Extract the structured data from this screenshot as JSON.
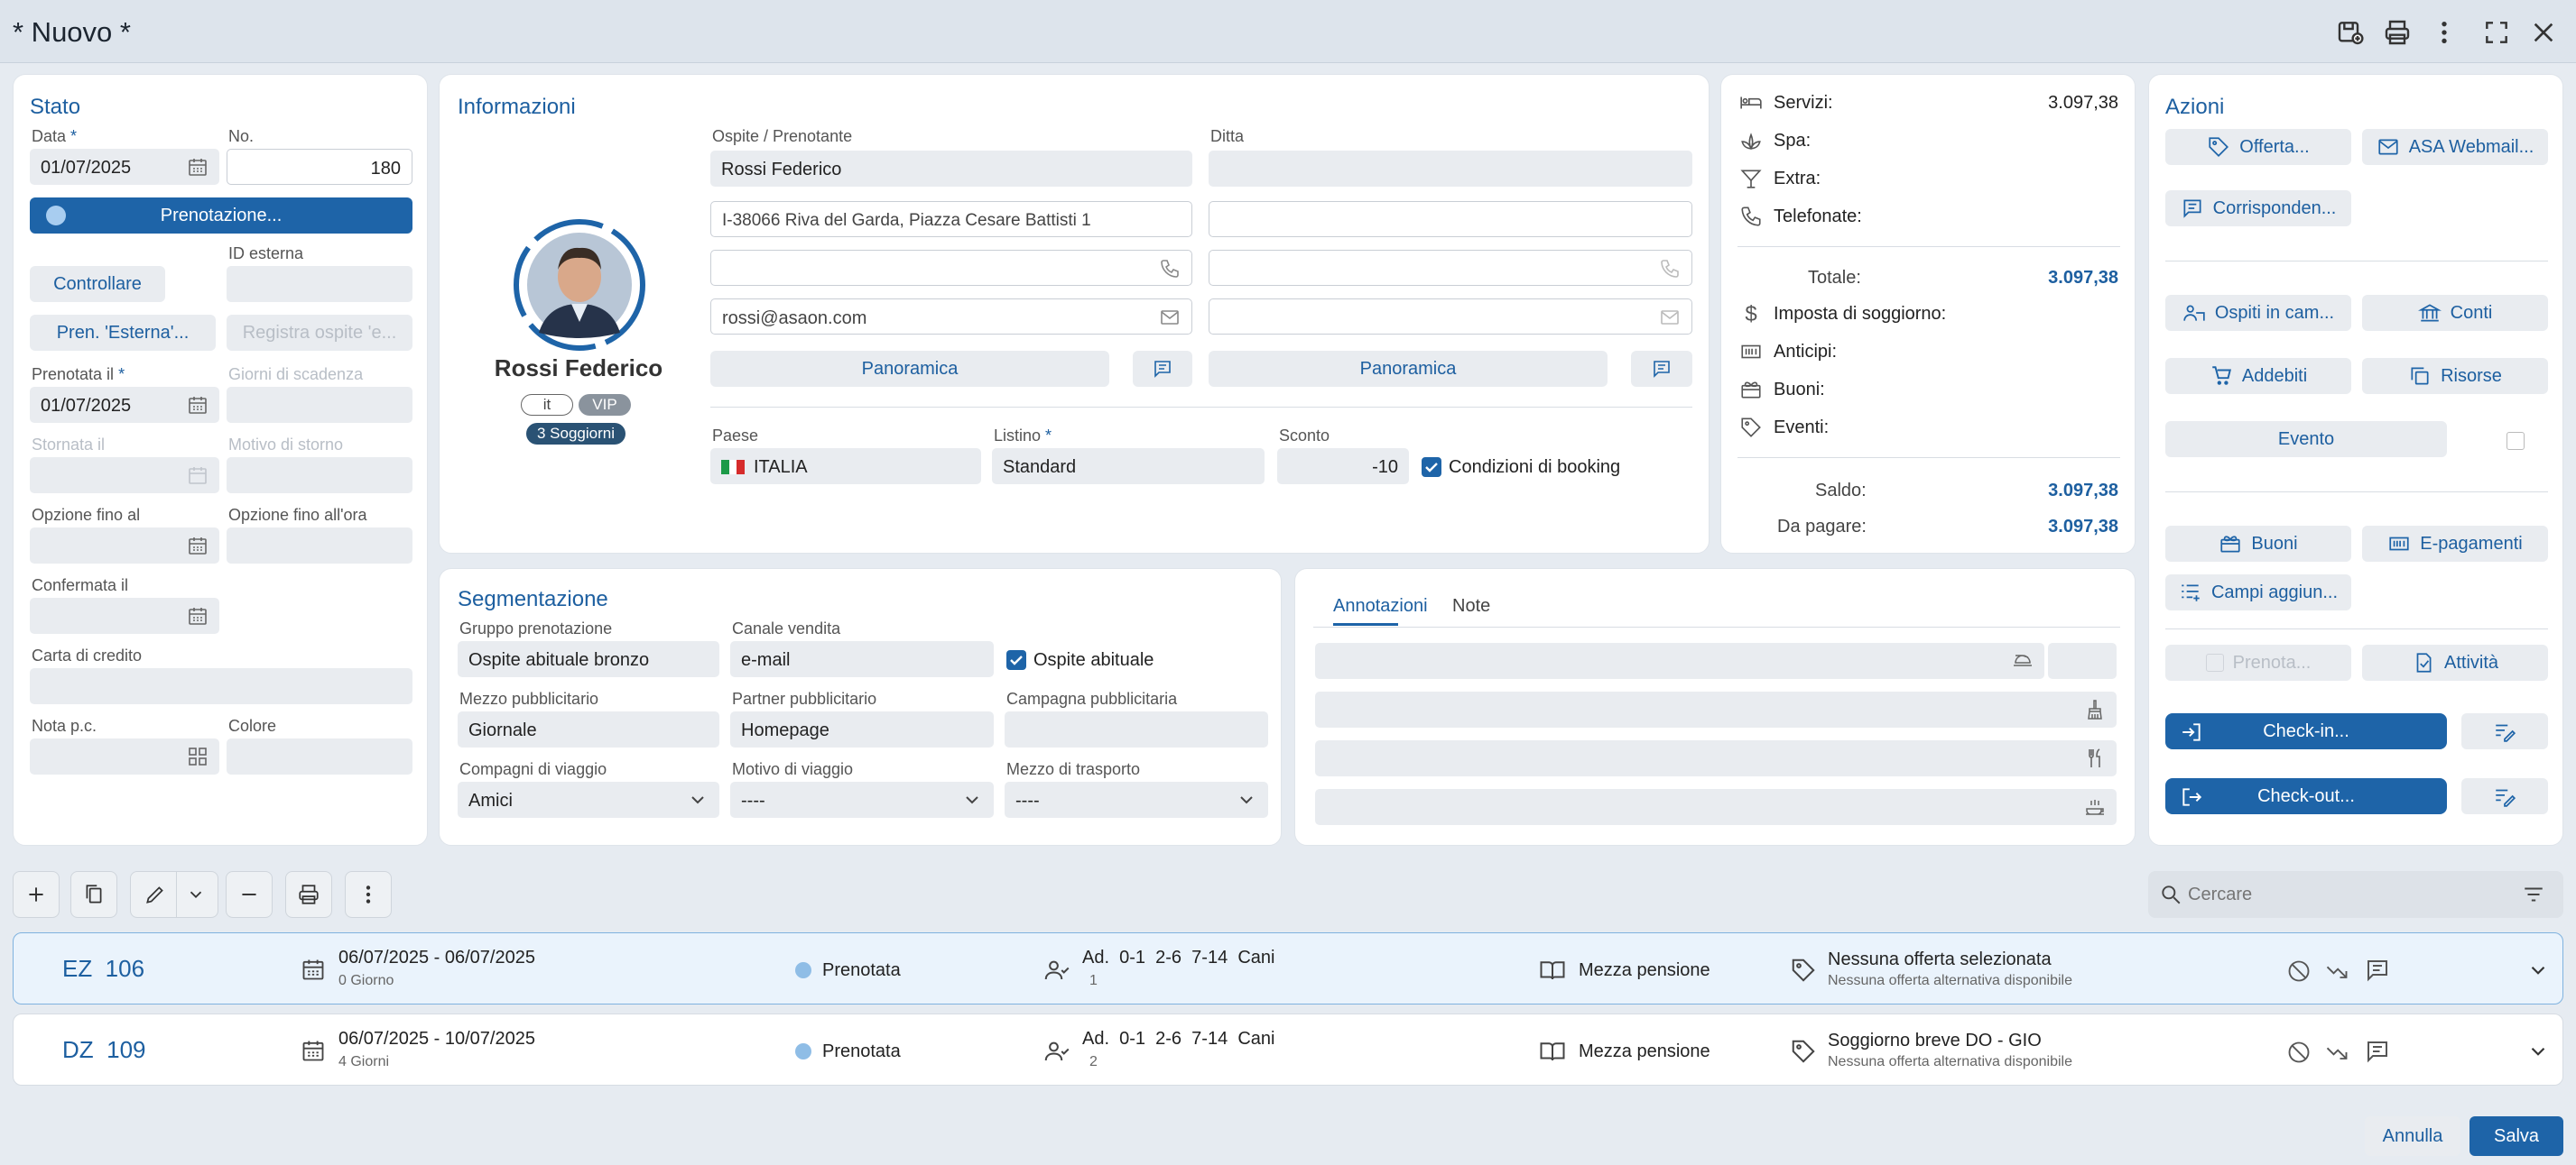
{
  "window": {
    "title": "* Nuovo *"
  },
  "stato": {
    "title": "Stato",
    "data_label": "Data",
    "data_value": "01/07/2025",
    "no_label": "No.",
    "no_value": "180",
    "prenotazione_button": "Prenotazione...",
    "controllare_button": "Controllare",
    "id_esterna_label": "ID esterna",
    "pren_esterna_button": "Pren. 'Esterna'...",
    "registra_button": "Registra ospite 'e...",
    "prenotata_il_label": "Prenotata il",
    "prenotata_il_value": "01/07/2025",
    "giorni_scadenza_label": "Giorni di scadenza",
    "stornata_il_label": "Stornata il",
    "motivo_storno_label": "Motivo di storno",
    "opzione_fino_al_label": "Opzione fino al",
    "opzione_fino_ora_label": "Opzione fino all'ora",
    "confermata_il_label": "Confermata il",
    "carta_credito_label": "Carta di credito",
    "nota_pc_label": "Nota p.c.",
    "colore_label": "Colore"
  },
  "informazioni": {
    "title": "Informazioni",
    "guest_name": "Rossi Federico",
    "lang_badge": "it",
    "vip_badge": "VIP",
    "stays_badge": "3 Soggiorni",
    "ospite_label": "Ospite / Prenotante",
    "ospite_value": "Rossi Federico",
    "ditta_label": "Ditta",
    "address_value": "I-38066 Riva del Garda, Piazza Cesare Battisti 1",
    "email_value": "rossi@asaon.com",
    "panoramica_left": "Panoramica",
    "panoramica_right": "Panoramica",
    "paese_label": "Paese",
    "paese_value": "ITALIA",
    "listino_label": "Listino",
    "listino_value": "Standard",
    "sconto_label": "Sconto",
    "sconto_value": "-10",
    "condizioni_label": "Condizioni di booking"
  },
  "summary": {
    "servizi_label": "Servizi:",
    "servizi_value": "3.097,38",
    "spa_label": "Spa:",
    "extra_label": "Extra:",
    "telefonate_label": "Telefonate:",
    "totale_label": "Totale:",
    "totale_value": "3.097,38",
    "imposta_label": "Imposta di soggiorno:",
    "anticipi_label": "Anticipi:",
    "buoni_label": "Buoni:",
    "eventi_label": "Eventi:",
    "saldo_label": "Saldo:",
    "saldo_value": "3.097,38",
    "da_pagare_label": "Da pagare:",
    "da_pagare_value": "3.097,38"
  },
  "azioni": {
    "title": "Azioni",
    "offerta": "Offerta...",
    "webmail": "ASA Webmail...",
    "corrispondenza": "Corrisponden...",
    "ospiti_camera": "Ospiti in cam...",
    "conti": "Conti",
    "addebiti": "Addebiti",
    "risorse": "Risorse",
    "evento": "Evento",
    "buoni": "Buoni",
    "e_pagamenti": "E-pagamenti",
    "campi_aggiuntivi": "Campi aggiun...",
    "prenota": "Prenota...",
    "attivita": "Attività",
    "checkin": "Check-in...",
    "checkout": "Check-out..."
  },
  "segmentazione": {
    "title": "Segmentazione",
    "gruppo_label": "Gruppo prenotazione",
    "gruppo_value": "Ospite abituale bronzo",
    "canale_label": "Canale vendita",
    "canale_value": "e-mail",
    "ospite_abituale_label": "Ospite abituale",
    "mezzo_label": "Mezzo pubblicitario",
    "mezzo_value": "Giornale",
    "partner_label": "Partner pubblicitario",
    "partner_value": "Homepage",
    "campagna_label": "Campagna pubblicitaria",
    "compagni_label": "Compagni di viaggio",
    "compagni_value": "Amici",
    "motivo_label": "Motivo di viaggio",
    "motivo_value": "----",
    "trasporto_label": "Mezzo di trasporto",
    "trasporto_value": "----"
  },
  "annotazioni": {
    "tab1": "Annotazioni",
    "tab2": "Note"
  },
  "search": {
    "placeholder": "Cercare"
  },
  "rooms": [
    {
      "code": "EZ  106",
      "dates": "06/07/2025 - 06/07/2025",
      "days": "0 Giorno",
      "status": "Prenotata",
      "guests": "Ad.  0-1  2-6  7-14  Cani",
      "count": "1",
      "board": "Mezza pensione",
      "offer": "Nessuna offerta selezionata",
      "offer_sub": "Nessuna offerta alternativa disponibile"
    },
    {
      "code": "DZ  109",
      "dates": "06/07/2025 - 10/07/2025",
      "days": "4 Giorni",
      "status": "Prenotata",
      "guests": "Ad.  0-1  2-6  7-14  Cani",
      "count": "2",
      "board": "Mezza pensione",
      "offer": "Soggiorno breve DO - GIO",
      "offer_sub": "Nessuna offerta alternativa disponibile"
    }
  ],
  "footer": {
    "annulla": "Annulla",
    "salva": "Salva"
  },
  "colors": {
    "accent": "#1e64a8",
    "status_dot": "#8fbde6"
  }
}
